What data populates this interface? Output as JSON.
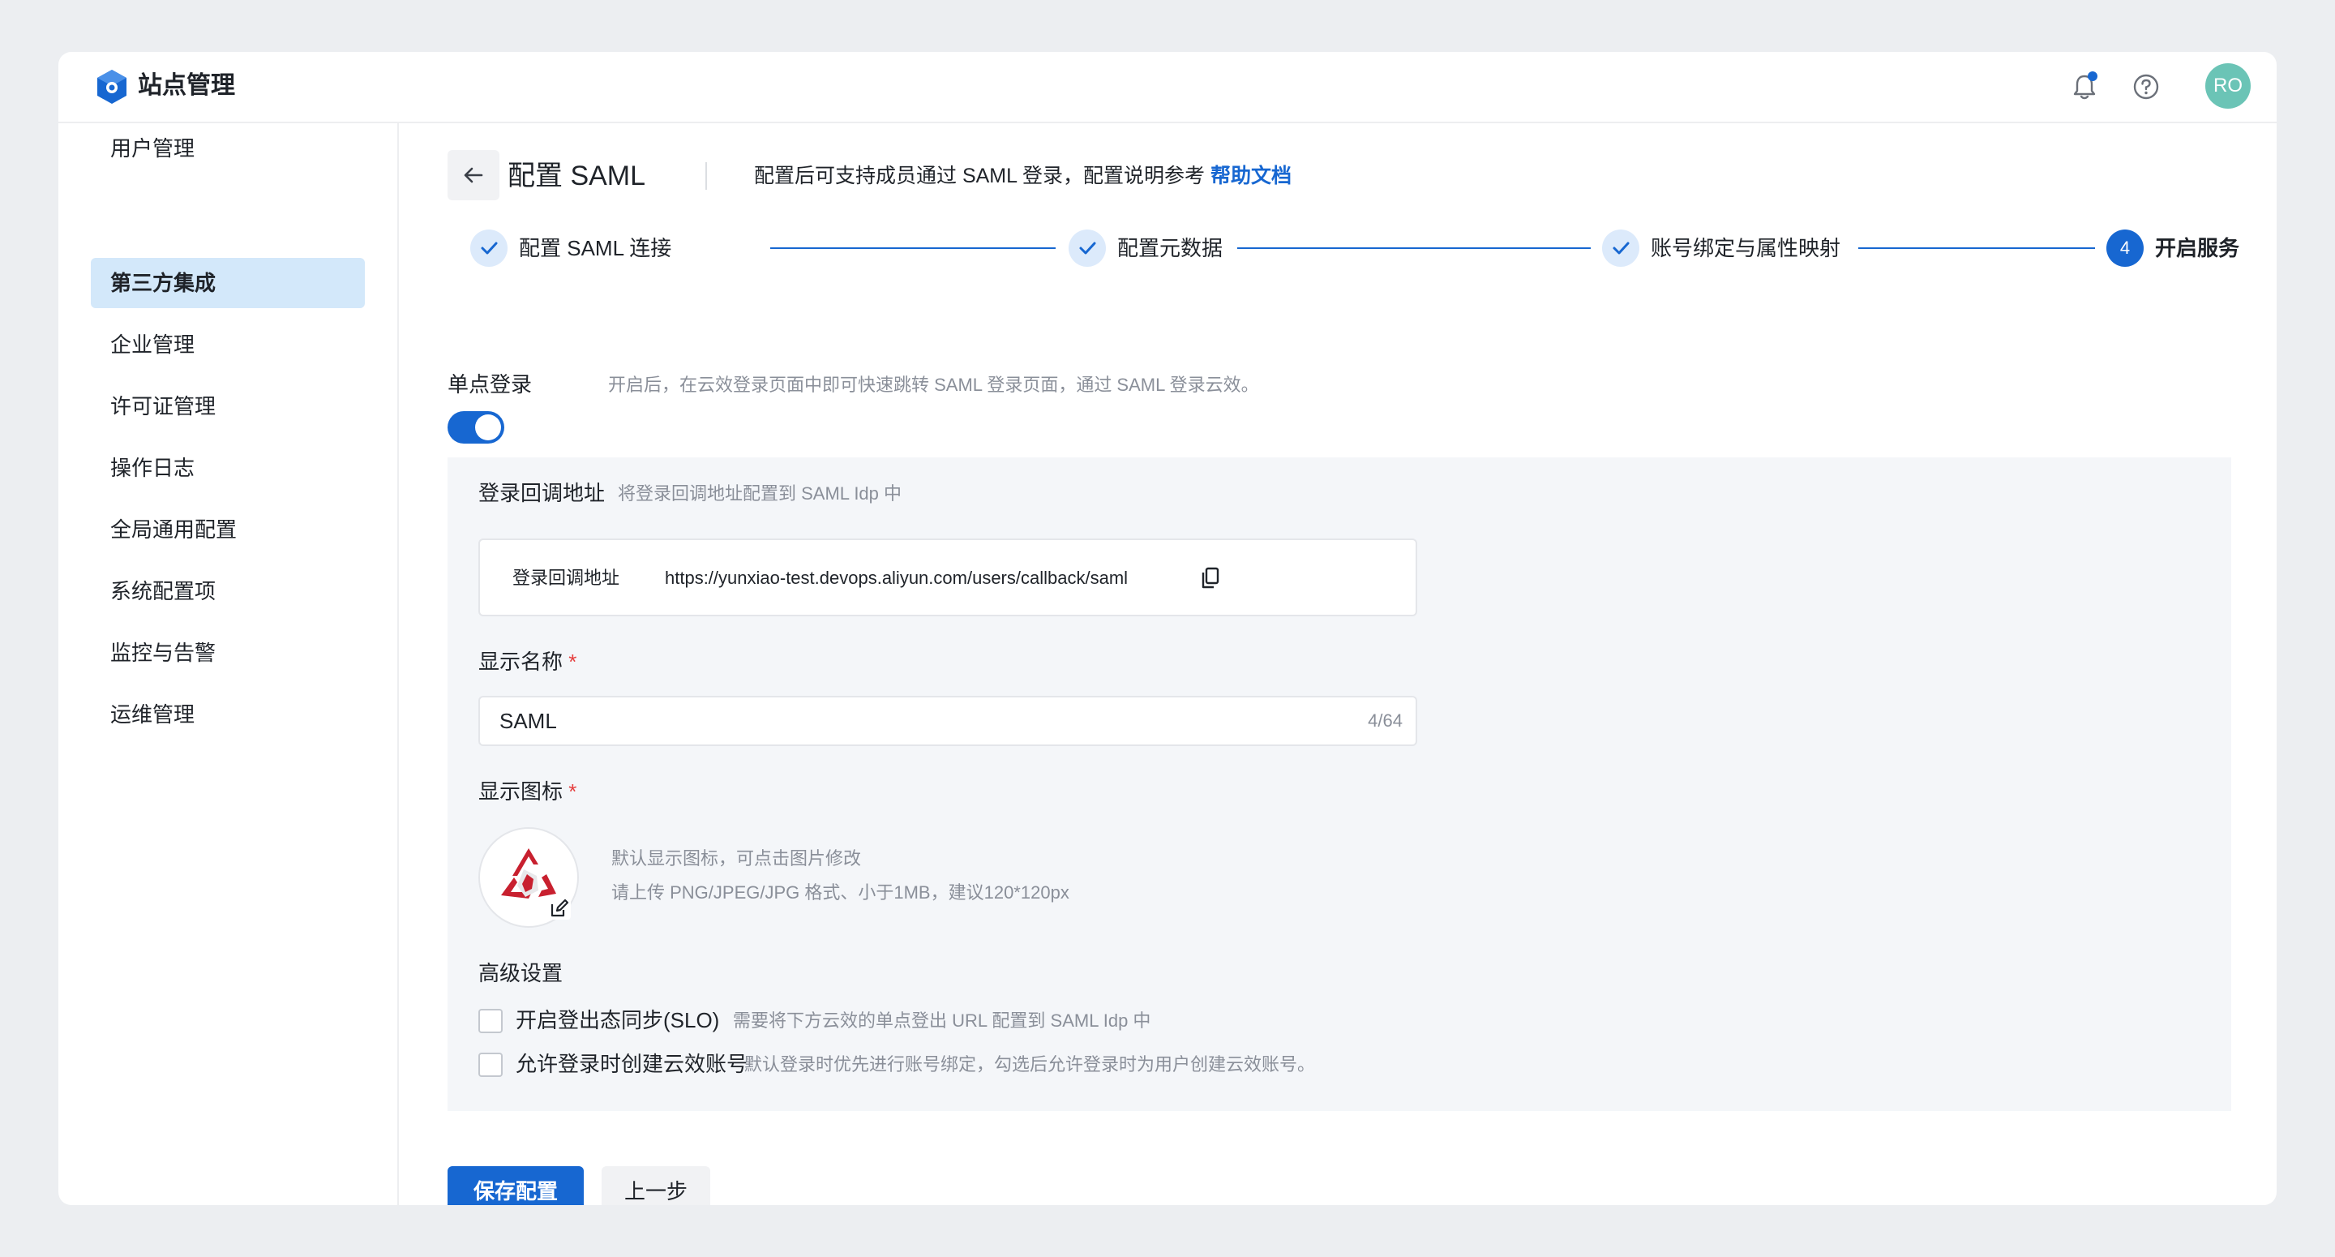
{
  "app": {
    "title": "站点管理"
  },
  "user": {
    "initials": "RO"
  },
  "sidebar": {
    "items": [
      {
        "label": "用户管理"
      },
      {
        "label": "第三方集成",
        "active": true
      },
      {
        "label": "企业管理"
      },
      {
        "label": "许可证管理"
      },
      {
        "label": "操作日志"
      },
      {
        "label": "全局通用配置"
      },
      {
        "label": "系统配置项"
      },
      {
        "label": "监控与告警"
      },
      {
        "label": "运维管理"
      }
    ]
  },
  "header": {
    "title": "配置 SAML",
    "subtitle": "配置后可支持成员通过 SAML 登录，配置说明参考",
    "help_link": "帮助文档"
  },
  "steps": [
    {
      "label": "配置 SAML 连接",
      "status": "done"
    },
    {
      "label": "配置元数据",
      "status": "done"
    },
    {
      "label": "账号绑定与属性映射",
      "status": "done"
    },
    {
      "label": "开启服务",
      "number": "4",
      "status": "current"
    }
  ],
  "sso": {
    "label": "单点登录",
    "hint": "开启后，在云效登录页面中即可快速跳转 SAML 登录页面，通过 SAML 登录云效。",
    "enabled": true
  },
  "callback": {
    "section_label": "登录回调地址",
    "section_hint": "将登录回调地址配置到 SAML Idp 中",
    "field_label": "登录回调地址",
    "url": "https://yunxiao-test.devops.aliyun.com/users/callback/saml"
  },
  "display_name": {
    "label": "显示名称",
    "required_mark": "*",
    "value": "SAML",
    "counter": "4/64"
  },
  "display_icon": {
    "label": "显示图标",
    "required_mark": "*",
    "hint1": "默认显示图标，可点击图片修改",
    "hint2": "请上传 PNG/JPEG/JPG 格式、小于1MB，建议120*120px"
  },
  "advanced": {
    "label": "高级设置",
    "options": [
      {
        "label": "开启登出态同步(SLO)",
        "hint": "需要将下方云效的单点登出 URL 配置到 SAML Idp 中",
        "checked": false
      },
      {
        "label": "允许登录时创建云效账号",
        "hint": "默认登录时优先进行账号绑定，勾选后允许登录时为用户创建云效账号。",
        "checked": false
      }
    ]
  },
  "actions": {
    "save_label": "保存配置",
    "prev_label": "上一步"
  },
  "colors": {
    "primary": "#1767d1",
    "active_nav_bg": "#d3e8fa",
    "avatar_bg": "#6bc4b6",
    "saml_logo_red": "#c8202f",
    "required": "#e53e3e"
  }
}
